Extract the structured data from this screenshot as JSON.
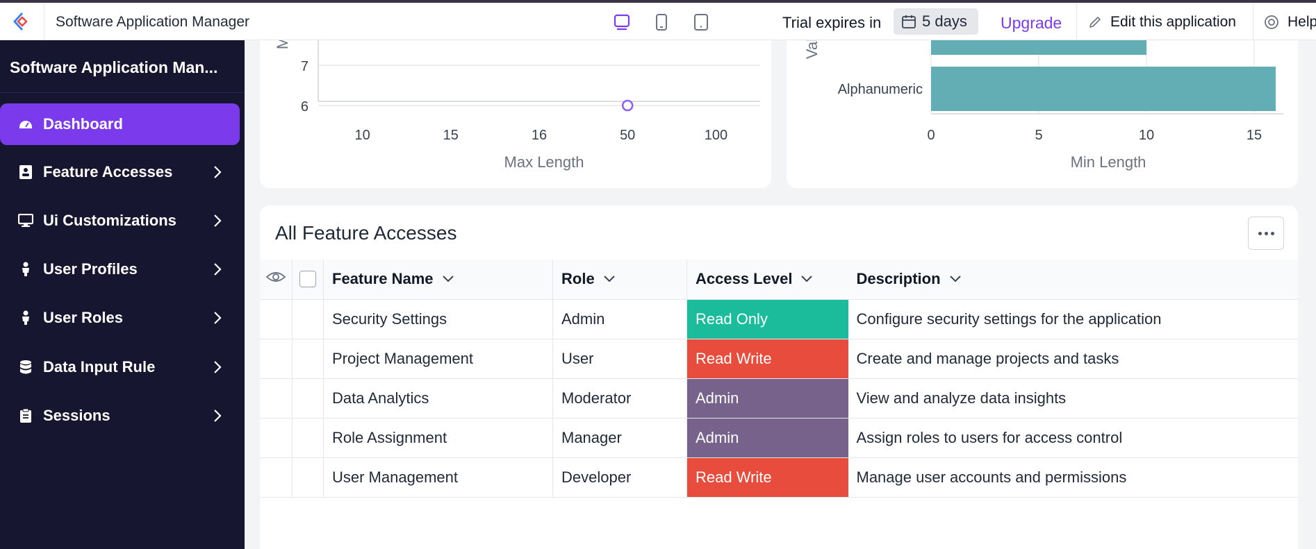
{
  "topbar": {
    "app_title": "Software Application Manager",
    "device_icons": [
      "desktop-icon",
      "mobile-icon",
      "tablet-icon"
    ],
    "trial_label": "Trial expires in",
    "trial_days": "5 days",
    "upgrade_label": "Upgrade",
    "edit_label": "Edit this application",
    "help_label": "Help"
  },
  "sidebar": {
    "app_title": "Software Application Man...",
    "items": [
      {
        "label": "Dashboard",
        "icon": "dashboard-icon",
        "active": true
      },
      {
        "label": "Feature Accesses",
        "icon": "id-badge-icon"
      },
      {
        "label": "Ui Customizations",
        "icon": "monitor-icon"
      },
      {
        "label": "User Profiles",
        "icon": "user-icon"
      },
      {
        "label": "User Roles",
        "icon": "user-icon"
      },
      {
        "label": "Data Input Rule",
        "icon": "database-icon"
      },
      {
        "label": "Sessions",
        "icon": "clipboard-icon"
      }
    ]
  },
  "colors": {
    "accent": "#7c3aed",
    "sidebar_bg": "#161630",
    "bar": "#63adb5",
    "read_only": "#1abc9c",
    "read_write": "#e74c3c",
    "admin": "#76628a"
  },
  "charts": [
    {
      "chart_data": {
        "type": "scatter",
        "x_categories": [
          "10",
          "15",
          "16",
          "50",
          "100"
        ],
        "y_ticks": [
          6,
          7
        ],
        "points": [
          {
            "x": "50",
            "y": 6
          }
        ],
        "xlabel": "Max Length",
        "ylabel": "M"
      }
    },
    {
      "chart_data": {
        "type": "bar",
        "orientation": "horizontal",
        "categories": [
          "Alphanumeric"
        ],
        "values": [
          16
        ],
        "partial_bar_above_value": 10,
        "x_ticks": [
          0,
          5,
          10,
          15
        ],
        "xlabel": "Min Length",
        "ylabel": "Val"
      }
    }
  ],
  "table": {
    "title": "All Feature Accesses",
    "columns": [
      "Feature Name",
      "Role",
      "Access Level",
      "Description"
    ],
    "rows": [
      {
        "feature": "Security Settings",
        "role": "Admin",
        "access": "Read Only",
        "access_color": "#1abc9c",
        "description": "Configure security settings for the application"
      },
      {
        "feature": "Project Management",
        "role": "User",
        "access": "Read Write",
        "access_color": "#e74c3c",
        "description": "Create and manage projects and tasks"
      },
      {
        "feature": "Data Analytics",
        "role": "Moderator",
        "access": "Admin",
        "access_color": "#76628a",
        "description": "View and analyze data insights"
      },
      {
        "feature": "Role Assignment",
        "role": "Manager",
        "access": "Admin",
        "access_color": "#76628a",
        "description": "Assign roles to users for access control"
      },
      {
        "feature": "User Management",
        "role": "Developer",
        "access": "Read Write",
        "access_color": "#e74c3c",
        "description": "Manage user accounts and permissions"
      }
    ]
  }
}
